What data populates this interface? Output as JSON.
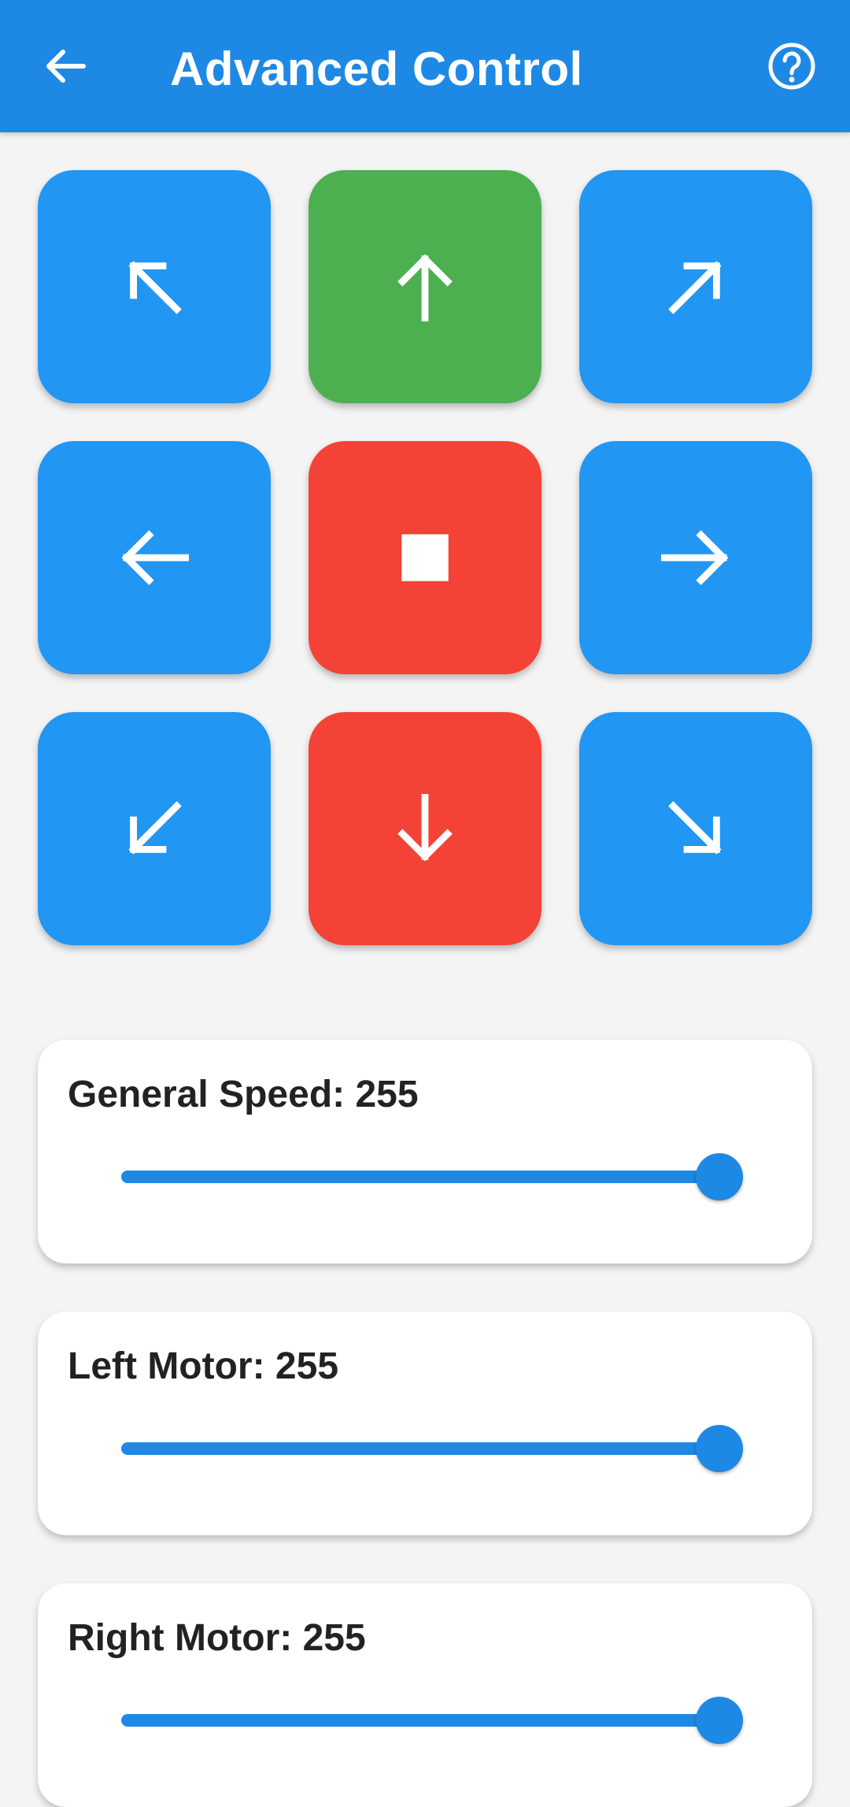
{
  "header": {
    "title": "Advanced Control",
    "back_icon": "arrow-left-icon",
    "help_icon": "help-circle-icon",
    "color": "#1e88e5"
  },
  "pad": {
    "buttons": [
      {
        "name": "forward-left",
        "icon": "arrow-up-left-icon",
        "color": "#2196f3"
      },
      {
        "name": "forward",
        "icon": "arrow-up-icon",
        "color": "#4caf50"
      },
      {
        "name": "forward-right",
        "icon": "arrow-up-right-icon",
        "color": "#2196f3"
      },
      {
        "name": "left",
        "icon": "arrow-left-icon",
        "color": "#2196f3"
      },
      {
        "name": "stop",
        "icon": "stop-icon",
        "color": "#f44336"
      },
      {
        "name": "right",
        "icon": "arrow-right-icon",
        "color": "#2196f3"
      },
      {
        "name": "backward-left",
        "icon": "arrow-down-left-icon",
        "color": "#2196f3"
      },
      {
        "name": "backward",
        "icon": "arrow-down-icon",
        "color": "#f44336"
      },
      {
        "name": "backward-right",
        "icon": "arrow-down-right-icon",
        "color": "#2196f3"
      }
    ]
  },
  "sliders": [
    {
      "label": "General Speed: 255",
      "value": 255,
      "max": 255
    },
    {
      "label": "Left Motor: 255",
      "value": 255,
      "max": 255
    },
    {
      "label": "Right Motor: 255",
      "value": 255,
      "max": 255
    }
  ]
}
